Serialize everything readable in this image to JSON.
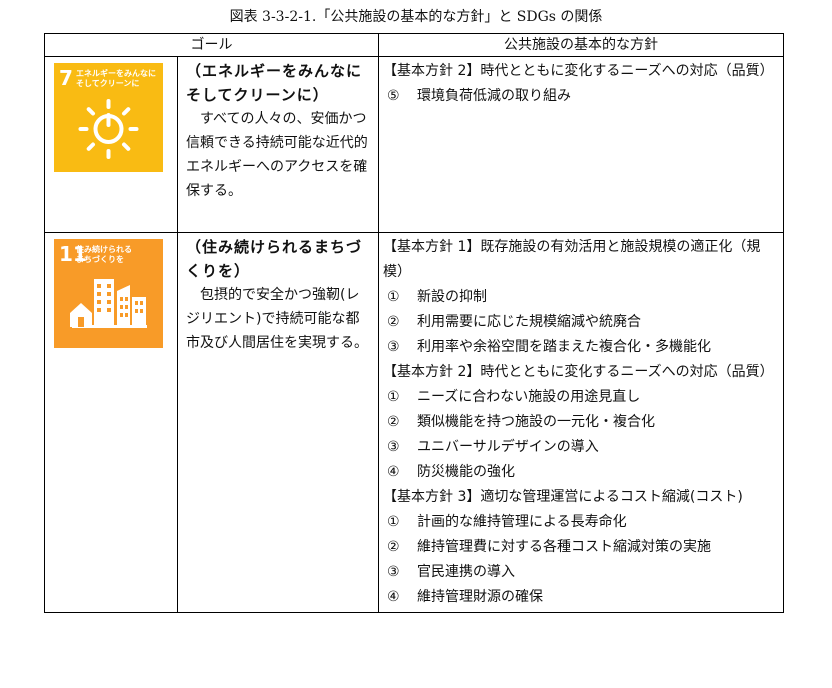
{
  "caption": "図表 3-3-2-1.「公共施設の基本的な方針」と SDGs の関係",
  "header": {
    "goal": "ゴール",
    "policy": "公共施設の基本的な方針"
  },
  "rows": [
    {
      "icon": {
        "number": "7",
        "title": "エネルギーをみんなに\nそしてクリーンに",
        "color": "#f9bb13",
        "symbol": "sun-power-icon"
      },
      "goal_head": "（エネルギーをみんなにそしてクリーンに）",
      "goal_desc": "すべての人々の、安価かつ信頼できる持続可能な近代的エネルギーへのアクセスを確保する。",
      "policies": [
        {
          "head": "【基本方針 2】時代とともに変化するニーズへの対応（品質）",
          "items": [
            {
              "num": "⑤",
              "text": "環境負荷低減の取り組み"
            }
          ]
        }
      ]
    },
    {
      "icon": {
        "number": "11",
        "title": "住み続けられる\nまちづくりを",
        "color": "#f89b28",
        "symbol": "city-buildings-icon"
      },
      "goal_head": "（住み続けられるまちづくりを）",
      "goal_desc": "包摂的で安全かつ強靭(レジリエント)で持続可能な都市及び人間居住を実現する。",
      "policies": [
        {
          "head": "【基本方針 1】既存施設の有効活用と施設規模の適正化（規模）",
          "items": [
            {
              "num": "①",
              "text": "新設の抑制"
            },
            {
              "num": "②",
              "text": "利用需要に応じた規模縮減や統廃合"
            },
            {
              "num": "③",
              "text": "利用率や余裕空間を踏まえた複合化・多機能化"
            }
          ]
        },
        {
          "head": "【基本方針 2】時代とともに変化するニーズへの対応（品質）",
          "items": [
            {
              "num": "①",
              "text": "ニーズに合わない施設の用途見直し"
            },
            {
              "num": "②",
              "text": "類似機能を持つ施設の一元化・複合化"
            },
            {
              "num": "③",
              "text": "ユニバーサルデザインの導入"
            },
            {
              "num": "④",
              "text": "防災機能の強化"
            }
          ]
        },
        {
          "head": "【基本方針 3】適切な管理運営によるコスト縮減(コスト)",
          "items": [
            {
              "num": "①",
              "text": "計画的な維持管理による長寿命化"
            },
            {
              "num": "②",
              "text": "維持管理費に対する各種コスト縮減対策の実施"
            },
            {
              "num": "③",
              "text": "官民連携の導入"
            },
            {
              "num": "④",
              "text": "維持管理財源の確保"
            }
          ]
        }
      ]
    }
  ]
}
